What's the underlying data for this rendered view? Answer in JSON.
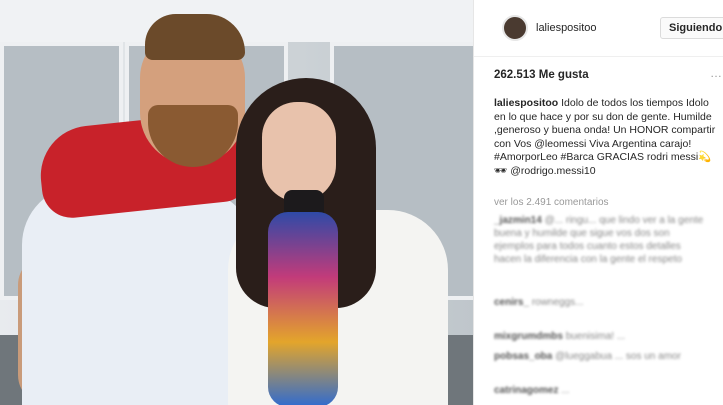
{
  "post": {
    "username": "laliespositoo",
    "follow_label": "Siguiendo",
    "likes_text": "262.513 Me gusta",
    "more_label": "…",
    "caption_user": "laliespositoo",
    "caption_text": "Idolo de todos los tiempos Idolo en lo que hace y por su don de gente. Humilde ,generoso y buena onda! Un HONOR compartir con Vos @leomessi Viva Argentina carajo! #AmorporLeo #Barca GRACIAS rodri messi💫🕶 @rodrigo.messi10",
    "view_all_comments": "ver los 2.491 comentarios"
  },
  "comments": [
    {
      "user": "_jazmin14",
      "text": "@... ringu... que lindo ver a la gente buena y humilde que sigue vos dos son ejemplos para todos cuanto estos detalles hacen la diferencia con la gente el respeto"
    },
    {
      "user": "cenirs_",
      "text": "rowneggs..."
    },
    {
      "user": "mixgrumdmbs",
      "text": "buenisima! ..."
    },
    {
      "user": "pobsas_oba",
      "text": "@lueggabua ... sos un amor"
    },
    {
      "user": "catrinagomez",
      "text": "..."
    }
  ]
}
